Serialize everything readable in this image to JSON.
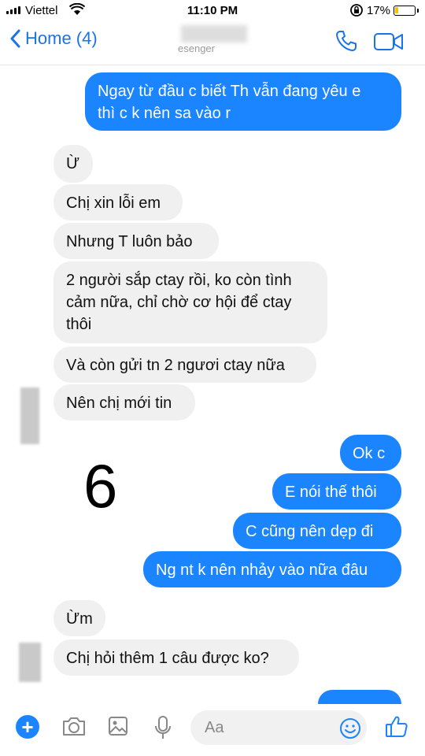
{
  "status_bar": {
    "carrier": "Viettel",
    "time": "11:10 PM",
    "battery_percent": "17%",
    "battery_level": 0.17
  },
  "nav": {
    "back_label": "Home (4)",
    "subtitle": "esenger"
  },
  "messages": [
    {
      "side": "out",
      "text_lines": [
        "Ngay từ đầu c biết Th vẫn đang yêu e",
        "thì c k nên sa vào r"
      ]
    },
    {
      "side": "in",
      "text_lines": [
        "Ừ"
      ]
    },
    {
      "side": "in",
      "text_lines": [
        "Chị xin lỗi em"
      ]
    },
    {
      "side": "in",
      "text_lines": [
        "Nhưng T luôn bảo"
      ]
    },
    {
      "side": "in",
      "text_lines": [
        "2 người sắp ctay rồi, ko còn tình",
        "cảm nữa, chỉ chờ cơ hội để ctay",
        "thôi"
      ]
    },
    {
      "side": "in",
      "text_lines": [
        "Và còn gửi tn 2 ngươi ctay nữa"
      ]
    },
    {
      "side": "in",
      "text_lines": [
        "Nên chị mới tin"
      ]
    },
    {
      "side": "out",
      "text_lines": [
        "Ok c"
      ]
    },
    {
      "side": "out",
      "text_lines": [
        "E nói thế thôi"
      ]
    },
    {
      "side": "out",
      "text_lines": [
        "C cũng nên dẹp đi"
      ]
    },
    {
      "side": "out",
      "text_lines": [
        "Ng nt k nên nhảy vào nữa đâu"
      ]
    },
    {
      "side": "in",
      "text_lines": [
        "Ừm"
      ]
    },
    {
      "side": "in",
      "text_lines": [
        "Chị hỏi thêm 1 câu được ko?"
      ]
    }
  ],
  "overlay_number": "6",
  "composer": {
    "placeholder": "Aa",
    "icons": [
      "plus-icon",
      "camera-icon",
      "image-icon",
      "microphone-icon",
      "emoji-icon",
      "thumbs-up-icon"
    ]
  },
  "colors": {
    "accent": "#1b84ff",
    "incoming_bubble": "#f0f0f0",
    "battery": "#f2c200"
  }
}
